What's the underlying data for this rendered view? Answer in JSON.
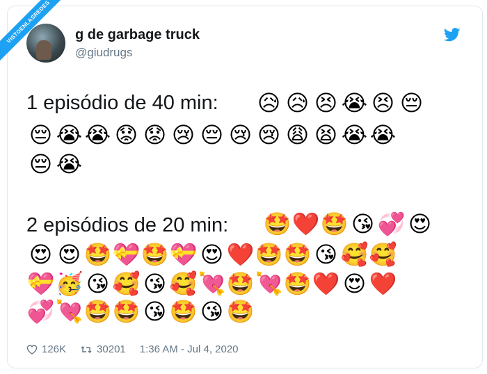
{
  "ribbon": {
    "text": "VISTOENLASREDES",
    "sub": ".com"
  },
  "user": {
    "display_name": "g de garbage truck",
    "handle": "@giudrugs"
  },
  "tweet": {
    "line1": "1 episódio de 40 min:",
    "line2": "2 episódios de 20 min:",
    "emojis_group1": [
      "😥",
      "😥",
      "😣",
      "😭",
      "😣",
      "😔",
      "😔",
      "😭",
      "😭",
      "😟",
      "😟",
      "😢",
      "😔",
      "😢",
      "😢",
      "😩",
      "😫",
      "😭",
      "😭",
      "😔",
      "😭"
    ],
    "emojis_group2": [
      "🤩",
      "❤️",
      "🤩",
      "😘",
      "💞",
      "😍",
      "😍",
      "😍",
      "🤩",
      "💝",
      "🤩",
      "💝",
      "😍",
      "❤️",
      "🤩",
      "🤩",
      "😘",
      "🥰",
      "🥰",
      "💝",
      "🥳",
      "😘",
      "🥰",
      "😘",
      "🥰",
      "💘",
      "🤩",
      "💘",
      "🤩",
      "❤️",
      "😍",
      "❤️",
      "💞",
      "💘",
      "🤩",
      "🤩",
      "😘",
      "🤩",
      "😘",
      "🤩"
    ]
  },
  "footer": {
    "likes": "126K",
    "retweets": "30201",
    "timestamp": "1:36 AM - Jul 4, 2020"
  },
  "colors": {
    "brand": "#1da1f2",
    "text": "#14171a",
    "muted": "#657786"
  }
}
